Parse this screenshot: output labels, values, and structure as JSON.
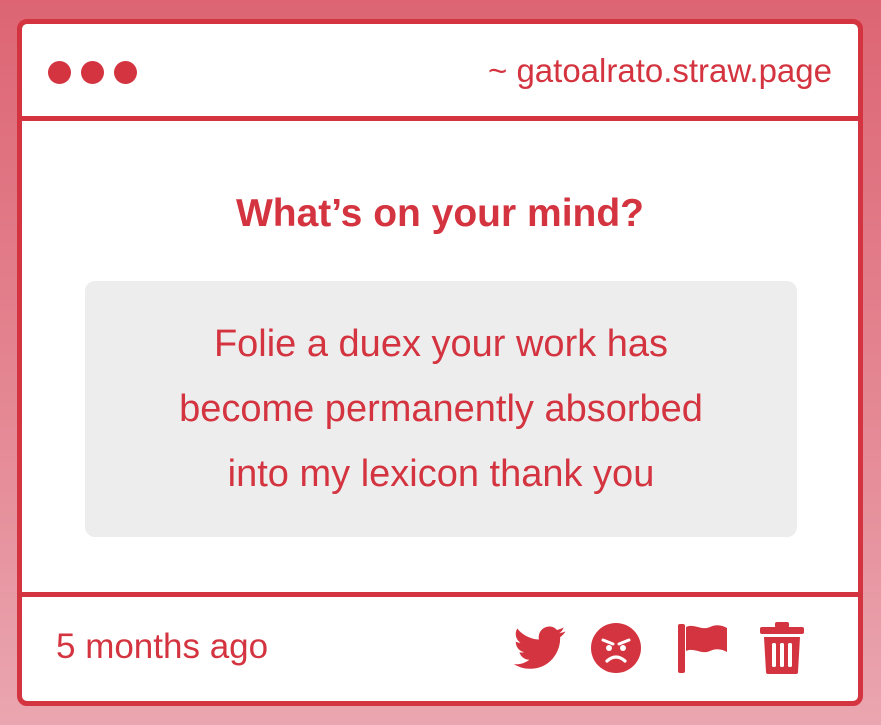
{
  "window": {
    "url": "~ gatoalrato.straw.page"
  },
  "main": {
    "question": "What’s on your mind?",
    "answer_lines": [
      "Folie a duex your work has",
      "become permanently absorbed",
      "into my lexicon thank you"
    ]
  },
  "footer": {
    "timestamp": "5 months ago",
    "actions": [
      "twitter-icon",
      "angry-face-icon",
      "flag-icon",
      "trash-icon"
    ]
  },
  "colors": {
    "accent": "#d3343f",
    "answer_bg": "#ededee"
  }
}
